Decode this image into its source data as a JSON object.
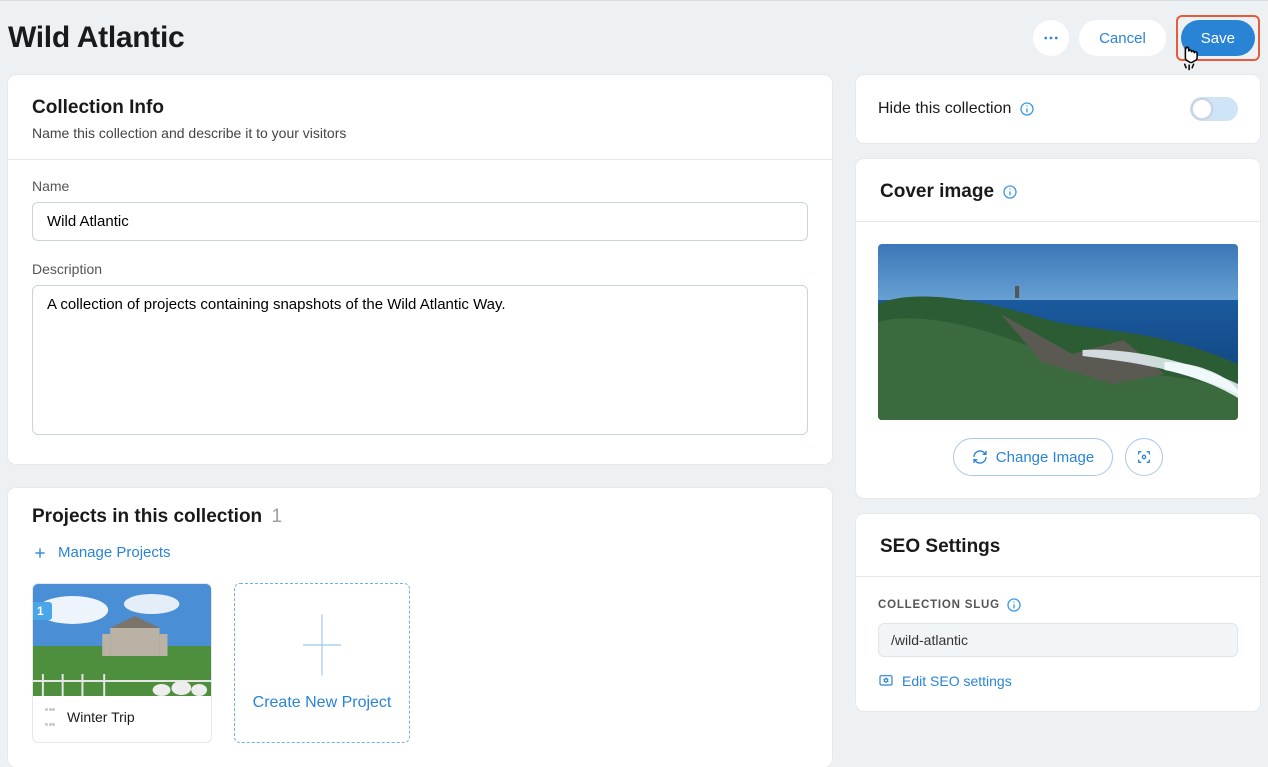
{
  "header": {
    "title": "Wild Atlantic",
    "cancel_label": "Cancel",
    "save_label": "Save"
  },
  "info": {
    "heading": "Collection Info",
    "sub": "Name this collection and describe it to your visitors",
    "name_label": "Name",
    "name_value": "Wild Atlantic",
    "desc_label": "Description",
    "desc_value": "A collection of projects containing snapshots of the Wild Atlantic Way."
  },
  "projects": {
    "heading": "Projects in this collection",
    "count": "1",
    "manage_label": "Manage Projects",
    "items": [
      {
        "title": "Winter Trip",
        "badge": "1"
      }
    ],
    "create_label": "Create New Project"
  },
  "hide": {
    "label": "Hide this collection",
    "on": false
  },
  "cover": {
    "heading": "Cover image",
    "change_label": "Change Image"
  },
  "seo": {
    "heading": "SEO Settings",
    "slug_label": "COLLECTION SLUG",
    "slug_value": "/wild-atlantic",
    "edit_label": "Edit SEO settings"
  }
}
